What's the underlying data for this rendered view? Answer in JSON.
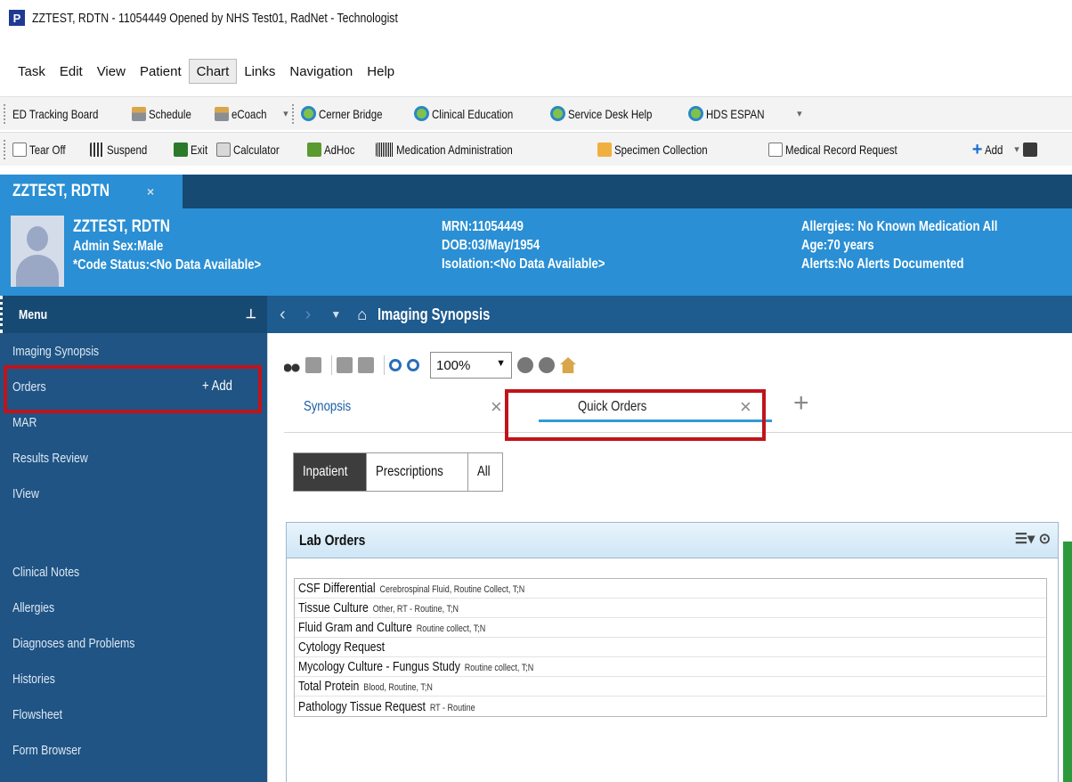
{
  "window": {
    "title": "ZZTEST, RDTN - 11054449 Opened by NHS Test01, RadNet - Technologist",
    "app_icon": "P"
  },
  "menubar": [
    {
      "label": "Task"
    },
    {
      "label": "Edit"
    },
    {
      "label": "View"
    },
    {
      "label": "Patient"
    },
    {
      "label": "Chart"
    },
    {
      "label": "Links"
    },
    {
      "label": "Navigation"
    },
    {
      "label": "Help"
    }
  ],
  "toolbar1": [
    {
      "label": "ED Tracking Board",
      "icon": "none"
    },
    {
      "label": "Schedule",
      "icon": "schedule-icon"
    },
    {
      "label": "eCoach",
      "icon": "schedule-icon"
    },
    {
      "label": "Cerner Bridge",
      "icon": "search-icon"
    },
    {
      "label": "Clinical Education",
      "icon": "search-icon"
    },
    {
      "label": "Service Desk Help",
      "icon": "search-icon"
    },
    {
      "label": "HDS ESPAN",
      "icon": "search-icon"
    }
  ],
  "toolbar2": [
    {
      "label": "Tear Off",
      "icon": "tear-off-icon"
    },
    {
      "label": "Suspend",
      "icon": "suspend-icon"
    },
    {
      "label": "Exit",
      "icon": "exit-icon"
    },
    {
      "label": "Calculator",
      "icon": "calculator-icon"
    },
    {
      "label": "AdHoc",
      "icon": "adhoc-icon"
    },
    {
      "label": "Medication Administration",
      "icon": "barcode-icon"
    },
    {
      "label": "Specimen Collection",
      "icon": "specimen-icon"
    },
    {
      "label": "Medical Record Request",
      "icon": "document-icon"
    },
    {
      "label": "Add",
      "icon": "plus-icon"
    }
  ],
  "patient_tab": {
    "label": "ZZTEST, RDTN",
    "close": "×"
  },
  "banner": {
    "name": "ZZTEST, RDTN",
    "admin_sex": "Admin Sex:Male",
    "code_status": "*Code Status:<No Data Available>",
    "mrn": "MRN:11054449",
    "dob": "DOB:03/May/1954",
    "isolation": "Isolation:<No Data Available>",
    "allergies": "Allergies: No Known Medication All",
    "age": "Age:70 years",
    "alerts": "Alerts:No Alerts Documented"
  },
  "sidebar": {
    "title": "Menu",
    "add_label": "+ Add",
    "items": [
      {
        "label": "Imaging Synopsis"
      },
      {
        "label": "Orders"
      },
      {
        "label": "MAR"
      },
      {
        "label": "Results Review"
      },
      {
        "label": "IView"
      },
      {
        "label": ""
      },
      {
        "label": "Clinical Notes"
      },
      {
        "label": "Allergies"
      },
      {
        "label": "Diagnoses and Problems"
      },
      {
        "label": "Histories"
      },
      {
        "label": "Flowsheet"
      },
      {
        "label": "Form Browser"
      }
    ]
  },
  "navbar": {
    "title": "Imaging Synopsis"
  },
  "content_toolbar": {
    "zoom": "100%"
  },
  "tabs": [
    {
      "label": "Synopsis"
    },
    {
      "label": "Quick Orders"
    }
  ],
  "segments": [
    {
      "label": "Inpatient",
      "active": true
    },
    {
      "label": "Prescriptions"
    },
    {
      "label": "All"
    }
  ],
  "lab_orders": {
    "title": "Lab Orders",
    "rows": [
      {
        "name": "CSF Differential",
        "detail": "Cerebrospinal Fluid, Routine Collect, T;N"
      },
      {
        "name": "Tissue Culture",
        "detail": "Other, RT - Routine, T;N"
      },
      {
        "name": "Fluid Gram and Culture",
        "detail": "Routine collect, T;N"
      },
      {
        "name": "Cytology Request",
        "detail": ""
      },
      {
        "name": "Mycology Culture - Fungus Study",
        "detail": "Routine collect, T;N"
      },
      {
        "name": "Total Protein",
        "detail": "Blood, Routine, T;N"
      },
      {
        "name": "Pathology Tissue Request",
        "detail": "RT - Routine"
      }
    ]
  },
  "colors": {
    "banner": "#2a8fd4",
    "sidebar": "#1f5484",
    "highlight": "#c0141b"
  }
}
